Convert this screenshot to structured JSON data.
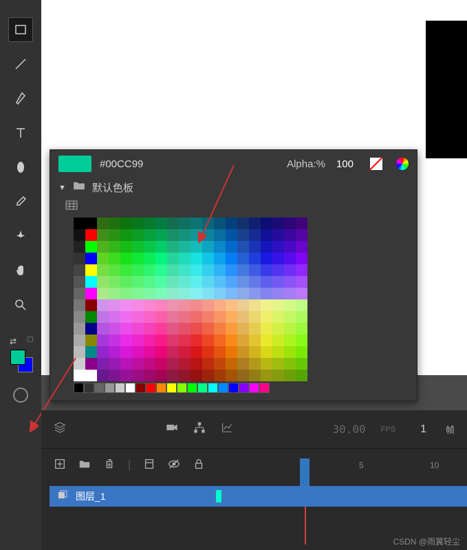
{
  "color_panel": {
    "hex": "#00CC99",
    "alpha_label": "Alpha:%",
    "alpha_value": "100",
    "palette_name": "默认色板",
    "current_color": "#00CC99"
  },
  "timeline": {
    "fps": "30.00",
    "fps_unit": "FPS",
    "frame": "1",
    "frame_unit": "帧",
    "ruler_marks": [
      "5",
      "10"
    ],
    "layer_name": "图层_1"
  },
  "swatches": {
    "foreground": "#00CC99",
    "background": "#0000ff"
  },
  "watermark": "CSDN @雨翼轻尘",
  "grays": [
    "#000000",
    "#1a1a1a",
    "#333333",
    "#4d4d4d",
    "#666666",
    "#808080",
    "#999999",
    "#b3b3b3",
    "#cccccc",
    "#e6e6e6",
    "#ffffff",
    "#ff0000",
    "#00ff00",
    "#0000ff"
  ],
  "primaries": [
    "#000000",
    "#ff0000",
    "#00ff00",
    "#0000ff",
    "#ffff00",
    "#00ffff",
    "#ff00ff",
    "#ffffff"
  ]
}
